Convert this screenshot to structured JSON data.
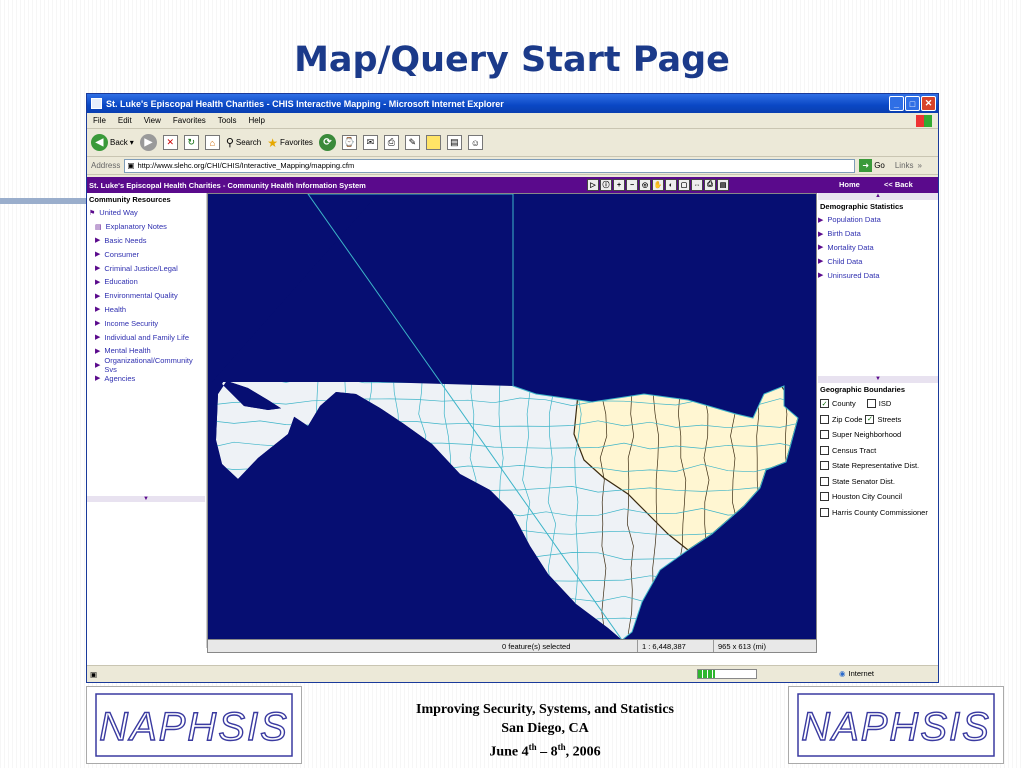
{
  "slide": {
    "title": "Map/Query Start Page",
    "footer": {
      "line1": "Improving Security, Systems, and Statistics",
      "line2": "San Diego, CA",
      "date_prefix": "June 4",
      "date_sup1": "th",
      "date_mid": " – 8",
      "date_sup2": "th",
      "date_suffix": ", 2006"
    },
    "logo_text": "NAPHSIS"
  },
  "browser": {
    "window_title": "St. Luke's Episcopal Health Charities - CHIS Interactive Mapping - Microsoft Internet Explorer",
    "menu": [
      "File",
      "Edit",
      "View",
      "Favorites",
      "Tools",
      "Help"
    ],
    "toolbar": {
      "back": "Back",
      "search": "Search",
      "favorites": "Favorites"
    },
    "address_label": "Address",
    "address_value": "http://www.slehc.org/CHI/CHIS/Interactive_Mapping/mapping.cfm",
    "go_label": "Go",
    "links_label": "Links",
    "status_zone": "Internet",
    "progress": 0.3
  },
  "app": {
    "header_title": "St. Luke's Episcopal Health Charities - Community Health Information System",
    "home": "Home",
    "back": "<< Back",
    "community": {
      "heading": "Community Resources",
      "root": "United Way",
      "items": [
        "Explanatory Notes",
        "Basic Needs",
        "Consumer",
        "Criminal Justice/Legal",
        "Education",
        "Environmental Quality",
        "Health",
        "Income Security",
        "Individual and Family Life",
        "Mental Health",
        "Organizational/Community Svs",
        "Agencies"
      ]
    },
    "demographic": {
      "heading": "Demographic Statistics",
      "items": [
        "Population Data",
        "Birth Data",
        "Mortality Data",
        "Child Data",
        "Uninsured Data"
      ]
    },
    "geographic": {
      "heading": "Geographic Boundaries",
      "county": "County",
      "isd": "ISD",
      "zip": "Zip Code",
      "streets": "Streets",
      "items": [
        "Super Neighborhood",
        "Census Tract",
        "State Representative Dist.",
        "State Senator Dist.",
        "Houston City Council",
        "Harris County Commissioner"
      ]
    },
    "map_status": {
      "features": "0 feature(s) selected",
      "scale": "1 : 6,448,387",
      "extent": "965 x 613 (mi)"
    },
    "colors": {
      "map_bg": "#060e72",
      "state_fill": "#eef2f6",
      "region_fill": "#fff6d2",
      "county_line": "#3cb4c8",
      "purple": "#5a0a8c"
    }
  }
}
